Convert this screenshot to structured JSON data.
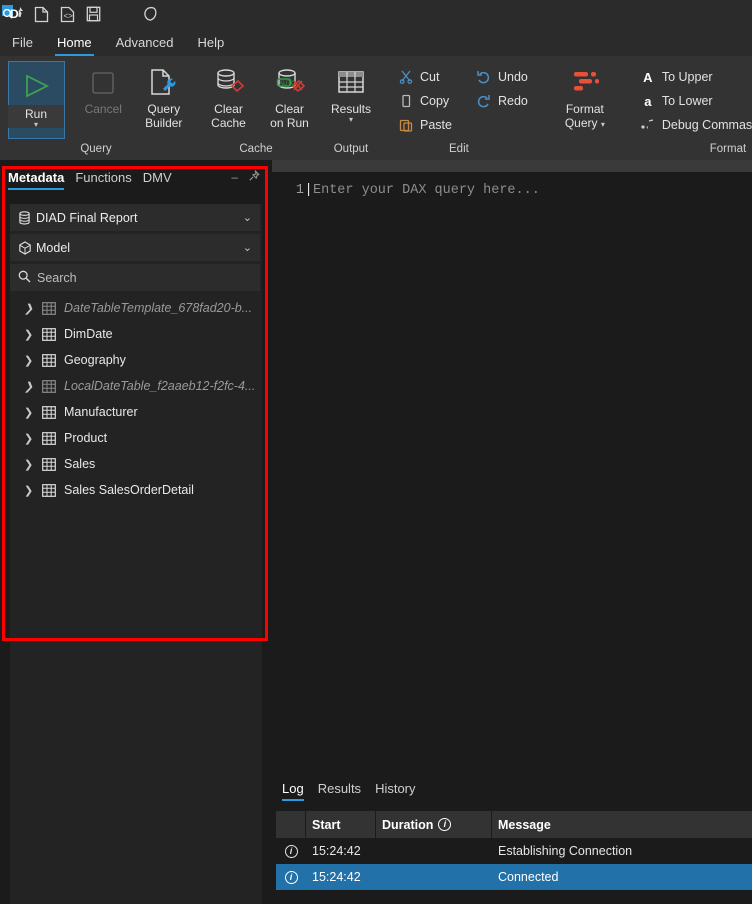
{
  "quick_access": {
    "logo_icon": "dax-studio-logo-icon",
    "buttons": [
      {
        "icon": "new-file-icon",
        "label": "New"
      },
      {
        "icon": "open-file-icon",
        "label": "Open"
      },
      {
        "icon": "save-icon",
        "label": "Save"
      }
    ],
    "theme_button": {
      "icon": "moon-icon",
      "label": "Dark Mode"
    }
  },
  "ribbon_tabs": [
    {
      "label": "File",
      "active": false
    },
    {
      "label": "Home",
      "active": true
    },
    {
      "label": "Advanced",
      "active": false
    },
    {
      "label": "Help",
      "active": false
    }
  ],
  "ribbon": {
    "groups": [
      {
        "name": "Query",
        "label": "Query",
        "items": [
          {
            "label": "Run",
            "icon": "play-icon",
            "state": "selected",
            "has_caret": true
          },
          {
            "label": "Cancel",
            "icon": "stop-icon",
            "state": "disabled",
            "has_caret": false
          },
          {
            "label_line1": "Query",
            "label_line2": "Builder",
            "icon": "query-builder-icon",
            "state": "normal",
            "has_caret": false
          }
        ]
      },
      {
        "name": "Cache",
        "label": "Cache",
        "items": [
          {
            "label_line1": "Clear",
            "label_line2": "Cache",
            "icon": "clear-cache-icon"
          },
          {
            "label_line1": "Clear",
            "label_line2": "on Run",
            "icon": "clear-on-run-icon"
          }
        ]
      },
      {
        "name": "Output",
        "label": "Output",
        "items": [
          {
            "label": "Results",
            "icon": "results-grid-icon",
            "has_caret": true
          }
        ]
      },
      {
        "name": "Edit",
        "label": "Edit",
        "columns": [
          [
            {
              "label": "Cut",
              "icon": "scissors-icon"
            },
            {
              "label": "Copy",
              "icon": "copy-icon"
            },
            {
              "label": "Paste",
              "icon": "paste-icon"
            }
          ],
          [
            {
              "label": "Undo",
              "icon": "undo-icon"
            },
            {
              "label": "Redo",
              "icon": "redo-icon"
            }
          ]
        ]
      },
      {
        "name": "Format",
        "label": "Format",
        "items": [
          {
            "label_line1": "Format",
            "label_line2": "Query",
            "icon": "format-query-icon",
            "has_caret": true
          }
        ],
        "columns": [
          [
            {
              "label": "To Upper",
              "icon": "uppercase-a-icon"
            },
            {
              "label": "To Lower",
              "icon": "lowercase-a-icon"
            },
            {
              "label": "Debug Commas",
              "icon": "debug-commas-icon"
            }
          ]
        ]
      }
    ]
  },
  "metadata_pane": {
    "tabs": [
      {
        "label": "Metadata",
        "active": true
      },
      {
        "label": "Functions",
        "active": false
      },
      {
        "label": "DMV",
        "active": false
      }
    ],
    "tools": [
      {
        "icon": "minimize-icon",
        "glyph": "–"
      },
      {
        "icon": "pin-icon",
        "glyph": "📌"
      }
    ],
    "connection_dropdown": {
      "icon": "database-icon",
      "value": "DIAD Final Report",
      "chevron": "chevron-down-icon"
    },
    "model_dropdown": {
      "icon": "model-cube-icon",
      "value": "Model",
      "chevron": "chevron-down-icon"
    },
    "search": {
      "icon": "search-icon",
      "placeholder": "Search",
      "value": ""
    },
    "tables": [
      {
        "name": "DateTableTemplate_678fad20-b...",
        "icon": "table-icon",
        "hidden": true
      },
      {
        "name": "DimDate",
        "icon": "table-icon",
        "hidden": false
      },
      {
        "name": "Geography",
        "icon": "table-icon",
        "hidden": false
      },
      {
        "name": "LocalDateTable_f2aaeb12-f2fc-4...",
        "icon": "table-icon",
        "hidden": true
      },
      {
        "name": "Manufacturer",
        "icon": "table-icon",
        "hidden": false
      },
      {
        "name": "Product",
        "icon": "table-icon",
        "hidden": false
      },
      {
        "name": "Sales",
        "icon": "table-icon",
        "hidden": false
      },
      {
        "name": "Sales SalesOrderDetail",
        "icon": "table-icon",
        "hidden": false
      }
    ],
    "highlight_color": "#fe0000"
  },
  "editor": {
    "line_number": "1",
    "placeholder": "Enter your DAX query here...",
    "cursor": "|"
  },
  "output_pane": {
    "tabs": [
      {
        "label": "Log",
        "active": true
      },
      {
        "label": "Results",
        "active": false
      },
      {
        "label": "History",
        "active": false
      }
    ],
    "columns": [
      "",
      "Start",
      "Duration",
      "Message"
    ],
    "duration_info_icon": "info-icon",
    "rows": [
      {
        "icon": "info-icon",
        "start": "15:24:42",
        "duration": "",
        "message": "Establishing Connection",
        "selected": false
      },
      {
        "icon": "info-icon",
        "start": "15:24:42",
        "duration": "",
        "message": "Connected",
        "selected": true
      }
    ]
  },
  "colors": {
    "accent": "#2d9ae0",
    "selection": "#2271a8",
    "run_green": "#3fa34d",
    "format_orange": "#e8503a",
    "highlight_red": "#fe0000"
  }
}
